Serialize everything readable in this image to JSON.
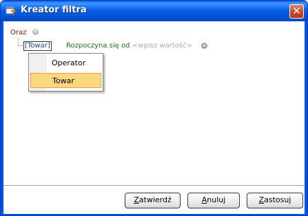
{
  "window": {
    "title": "Kreator filtra"
  },
  "condition": {
    "group_operator": "Oraz",
    "field": "[Towar]",
    "operator": "Rozpoczyna się od",
    "value_placeholder": "<wpisz wartość>"
  },
  "menu": {
    "items": [
      {
        "label": "Operator"
      },
      {
        "label": "Towar"
      }
    ],
    "highlighted": "Towar"
  },
  "buttons": {
    "ok": {
      "first": "Z",
      "rest": "atwierdź"
    },
    "cancel": {
      "first": "A",
      "rest": "nuluj"
    },
    "apply": {
      "first": "Z",
      "rest": "astosuj"
    }
  },
  "colors": {
    "titlebar": "#0a62e6",
    "group_operator": "#c00000",
    "field": "#1f3fa6",
    "operator": "#14781e",
    "placeholder": "#aaaaaa",
    "menu_highlight": "#fbd880"
  },
  "icons": {
    "title": "filter-wizard-icon",
    "close": "close-icon",
    "add": "plus-circle-icon",
    "remove": "remove-circle-icon"
  }
}
